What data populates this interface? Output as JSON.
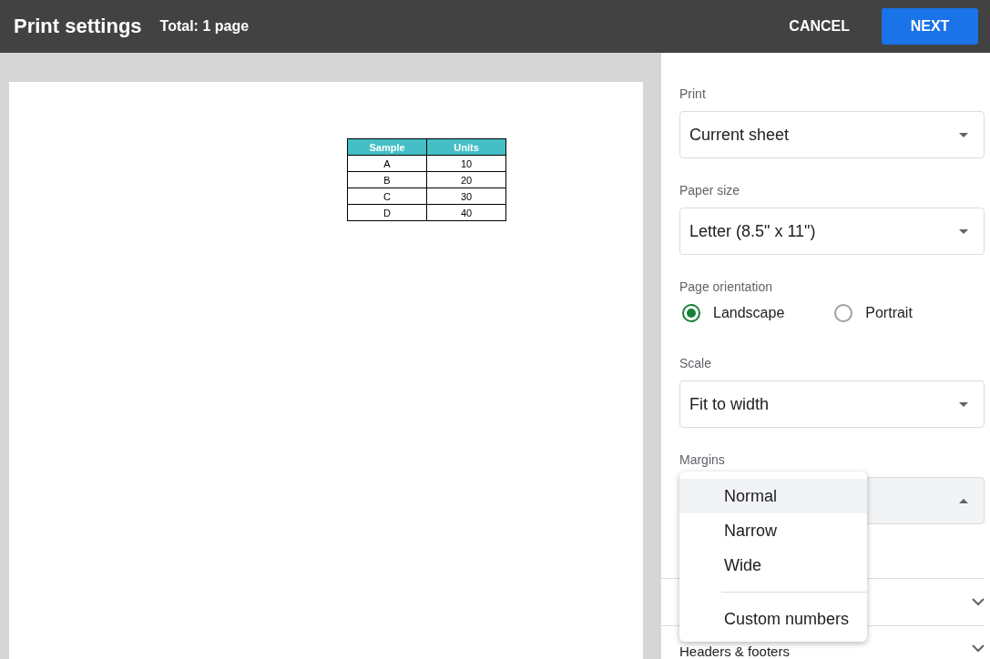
{
  "header": {
    "title": "Print settings",
    "total": "Total: 1 page",
    "buttons": [
      {
        "label": "CANCEL",
        "kind": "text"
      },
      {
        "label": "NEXT",
        "kind": "primary"
      }
    ]
  },
  "preview": {
    "table": {
      "columns": [
        "Sample",
        "Units"
      ],
      "rows": [
        [
          "A",
          "10"
        ],
        [
          "B",
          "20"
        ],
        [
          "C",
          "30"
        ],
        [
          "D",
          "40"
        ]
      ]
    }
  },
  "settings": {
    "print": {
      "label": "Print",
      "value": "Current sheet"
    },
    "paper_size": {
      "label": "Paper size",
      "value": "Letter (8.5\" x 11\")"
    },
    "orientation": {
      "label": "Page orientation",
      "options": [
        {
          "label": "Landscape",
          "selected": true
        },
        {
          "label": "Portrait",
          "selected": false
        }
      ]
    },
    "scale": {
      "label": "Scale",
      "value": "Fit to width"
    },
    "margins": {
      "label": "Margins",
      "expanded": true,
      "options": [
        {
          "label": "Normal",
          "selected": true,
          "kind": "option"
        },
        {
          "label": "Narrow",
          "selected": false,
          "kind": "option"
        },
        {
          "label": "Wide",
          "selected": false,
          "kind": "option"
        },
        {
          "label": "Custom numbers",
          "selected": false,
          "kind": "custom"
        }
      ]
    },
    "sections": [
      {
        "expanded": false
      },
      {
        "title": "Headers & footers",
        "expanded": false
      }
    ]
  }
}
